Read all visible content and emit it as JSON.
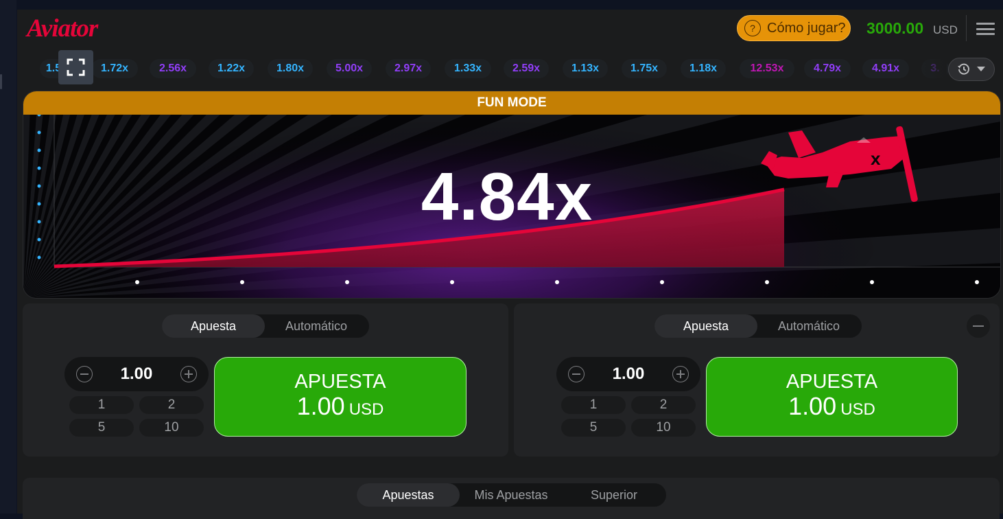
{
  "header": {
    "logo": "Aviator",
    "how_to_play": "Cómo jugar?",
    "balance": "3000.00",
    "currency": "USD"
  },
  "history": {
    "multipliers": [
      {
        "value": "1.5",
        "color": "#34b4ff"
      },
      {
        "value": "1.72x",
        "color": "#34b4ff"
      },
      {
        "value": "2.56x",
        "color": "#913ef8"
      },
      {
        "value": "1.22x",
        "color": "#34b4ff"
      },
      {
        "value": "1.80x",
        "color": "#34b4ff"
      },
      {
        "value": "5.00x",
        "color": "#913ef8"
      },
      {
        "value": "2.97x",
        "color": "#913ef8"
      },
      {
        "value": "1.33x",
        "color": "#34b4ff"
      },
      {
        "value": "2.59x",
        "color": "#913ef8"
      },
      {
        "value": "1.13x",
        "color": "#34b4ff"
      },
      {
        "value": "1.75x",
        "color": "#34b4ff"
      },
      {
        "value": "1.18x",
        "color": "#34b4ff"
      },
      {
        "value": "12.53x",
        "color": "#c017b4"
      },
      {
        "value": "4.79x",
        "color": "#913ef8"
      },
      {
        "value": "4.91x",
        "color": "#913ef8"
      },
      {
        "value": "3.",
        "color": "#913ef8"
      }
    ]
  },
  "game": {
    "mode_banner": "FUN MODE",
    "multiplier": "4.84x",
    "curve_color": "#e50539"
  },
  "bet_panels": [
    {
      "tabs": [
        "Apuesta",
        "Automático"
      ],
      "active_tab": 0,
      "amount": "1.00",
      "quick_amounts": [
        "1",
        "2",
        "5",
        "10"
      ],
      "button_label": "APUESTA",
      "button_amount": "1.00",
      "button_currency": "USD"
    },
    {
      "tabs": [
        "Apuesta",
        "Automático"
      ],
      "active_tab": 0,
      "amount": "1.00",
      "quick_amounts": [
        "1",
        "2",
        "5",
        "10"
      ],
      "button_label": "APUESTA",
      "button_amount": "1.00",
      "button_currency": "USD"
    }
  ],
  "bottom_tabs": [
    "Apuestas",
    "Mis Apuestas",
    "Superior"
  ],
  "colors": {
    "accent_red": "#e50539",
    "bet_green": "#28a909",
    "fun_mode": "#c47f04",
    "how_to_orange": "#e69308"
  },
  "icons": {
    "fullscreen": "fullscreen-icon",
    "history": "history-clock-icon",
    "menu": "hamburger-menu-icon",
    "plane": "airplane-icon"
  }
}
